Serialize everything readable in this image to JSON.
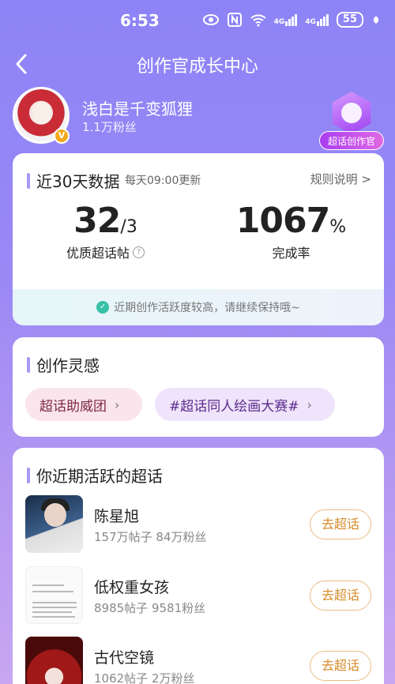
{
  "status_bar": {
    "time": "6:53",
    "icons": [
      "eye-icon",
      "nfc-icon",
      "wifi-icon",
      "signal-4g-icon",
      "signal-4g-icon-2",
      "battery-icon",
      "leaf-icon"
    ],
    "signal1_label": "4G",
    "signal2_label": "4G",
    "battery_level": "55"
  },
  "header": {
    "title": "创作官成长中心"
  },
  "profile": {
    "username": "浅白是千变狐狸",
    "fans": "1.1万粉丝",
    "verified_badge": "V",
    "creator_badge_label": "超话创作官"
  },
  "stats_card": {
    "title": "近30天数据",
    "update_note": "每天09:00更新",
    "rules_link": "规则说明 >",
    "posts_value": "32",
    "posts_unit": "/3",
    "posts_label": "优质超话帖",
    "completion_value": "1067",
    "completion_unit": "%",
    "completion_label": "完成率",
    "tip": "近期创作活跃度较高，请继续保持哦~"
  },
  "inspiration_card": {
    "title": "创作灵感",
    "tags": [
      {
        "label": "超话助威团"
      },
      {
        "label": "#超话同人绘画大赛#"
      }
    ]
  },
  "active_card": {
    "title": "你近期活跃的超话",
    "button_label": "去超话",
    "items": [
      {
        "name": "陈星旭",
        "meta": "157万帖子 84万粉丝"
      },
      {
        "name": "低权重女孩",
        "meta": "8985帖子 9581粉丝"
      },
      {
        "name": "古代空镜",
        "meta": "1062帖子 2万粉丝"
      }
    ]
  },
  "colors": {
    "accent": "#a997f4",
    "go_button": "#d68a28",
    "tip_check": "#37c1a8"
  }
}
